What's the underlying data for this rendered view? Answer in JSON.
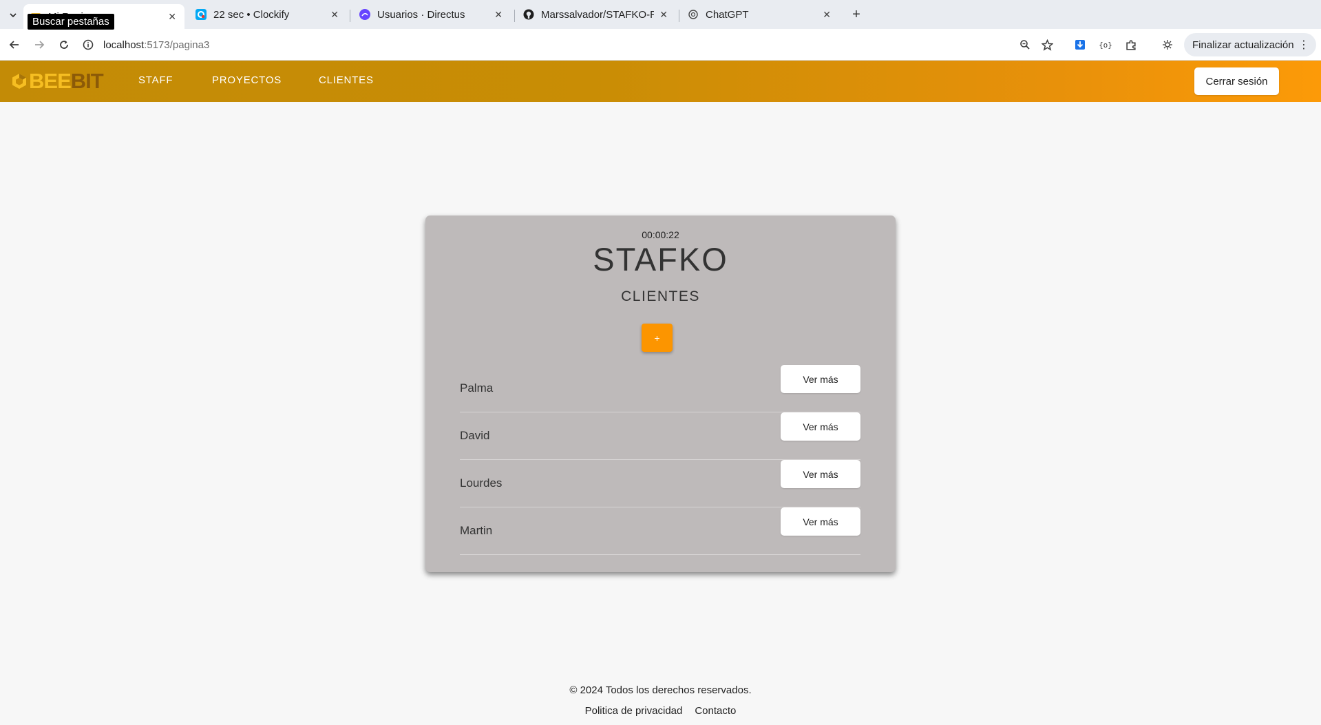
{
  "browser": {
    "tab_search_tooltip": "Buscar pestañas",
    "tabs": [
      {
        "title": "Mi    Regi",
        "icon": "folder-favicon-icon",
        "active": true
      },
      {
        "title": "22 sec • Clockify",
        "icon": "clockify-favicon-icon",
        "active": false
      },
      {
        "title": "Usuarios · Directus",
        "icon": "directus-favicon-icon",
        "active": false
      },
      {
        "title": "Marssalvador/STAFKO-F",
        "icon": "github-favicon-icon",
        "active": false
      },
      {
        "title": "ChatGPT",
        "icon": "chatgpt-favicon-icon",
        "active": false
      }
    ],
    "new_tab_label": "+",
    "url_host": "localhost",
    "url_rest": ":5173/pagina3",
    "update_label": "Finalizar actualización"
  },
  "navbar": {
    "logo_bee": "BEE",
    "logo_bit": "BIT",
    "links": [
      "STAFF",
      "PROYECTOS",
      "CLIENTES"
    ],
    "logout_label": "Cerrar sesión"
  },
  "card": {
    "timer": "00:00:22",
    "title": "STAFKO",
    "section": "CLIENTES",
    "add_label": "+",
    "clients": [
      {
        "name": "Palma",
        "button": "Ver más"
      },
      {
        "name": "David",
        "button": "Ver más"
      },
      {
        "name": "Lourdes",
        "button": "Ver más"
      },
      {
        "name": "Martin",
        "button": "Ver más"
      }
    ]
  },
  "footer": {
    "copyright": "© 2024 Todos los derechos reservados.",
    "privacy": "Politica de privacidad",
    "contact": "Contacto"
  },
  "colors": {
    "navbar_start": "#c38b06",
    "navbar_end": "#fc9a08",
    "add_button": "#fc9500",
    "card_bg": "#bebaba",
    "page_bg": "#f7f7f7"
  }
}
